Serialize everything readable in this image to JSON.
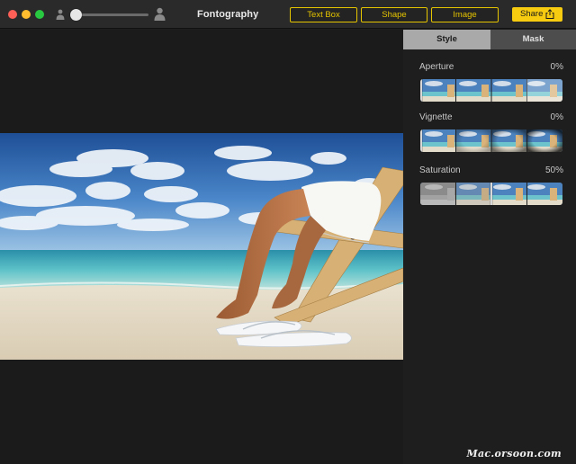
{
  "window": {
    "app_title": "Fontography"
  },
  "toolbar": {
    "modes": [
      "Text Box",
      "Shape",
      "Image"
    ],
    "share_label": "Share",
    "zoom_fraction": 0.0
  },
  "panel": {
    "tabs": [
      "Style",
      "Mask"
    ],
    "active_tab": "Style",
    "adjustments": [
      {
        "label": "Aperture",
        "value": "0%",
        "fraction": 0.0
      },
      {
        "label": "Vignette",
        "value": "0%",
        "fraction": 0.0
      },
      {
        "label": "Saturation",
        "value": "50%",
        "fraction": 0.5
      }
    ]
  },
  "watermark": "Mac.orsoon.com",
  "colors": {
    "accent": "#e5c400",
    "share_bg": "#f6cb10",
    "tab_active": "#a9a9a9",
    "tab_inactive": "#4d4d4d",
    "background": "#1e1e1e"
  },
  "icons": [
    "person-small-icon",
    "person-large-icon",
    "share-icon"
  ]
}
